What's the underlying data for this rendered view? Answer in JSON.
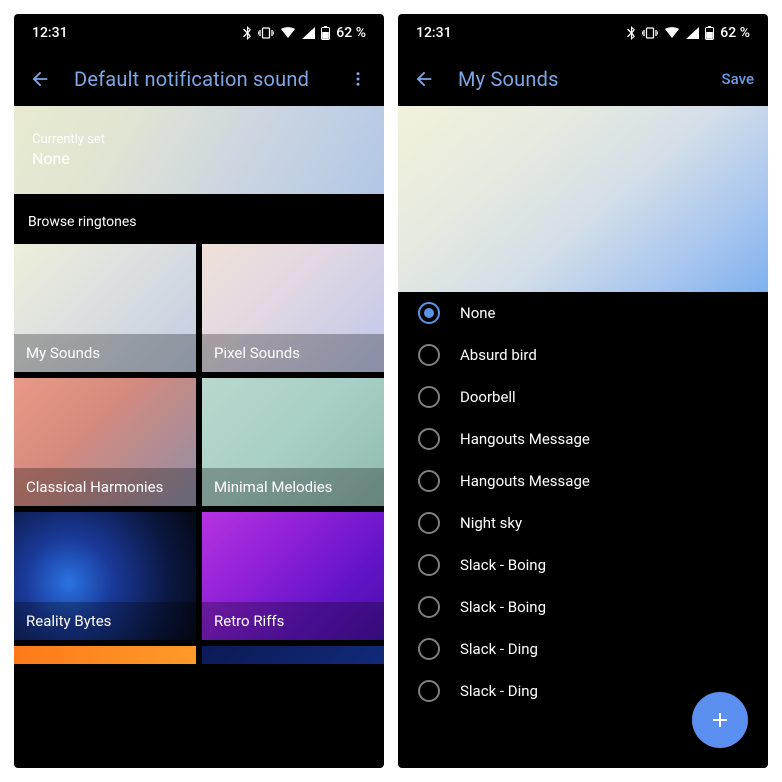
{
  "status": {
    "time": "12:31",
    "battery_text": "62 %"
  },
  "left": {
    "title": "Default notification sound",
    "current_label": "Currently set",
    "current_value": "None",
    "browse_label": "Browse ringtones",
    "categories": [
      {
        "name": "My Sounds"
      },
      {
        "name": "Pixel Sounds"
      },
      {
        "name": "Classical Harmonies"
      },
      {
        "name": "Minimal Melodies"
      },
      {
        "name": "Reality Bytes"
      },
      {
        "name": "Retro Riffs"
      }
    ]
  },
  "right": {
    "title": "My Sounds",
    "save_label": "Save",
    "sounds": [
      {
        "label": "None",
        "selected": true
      },
      {
        "label": "Absurd bird",
        "selected": false
      },
      {
        "label": "Doorbell",
        "selected": false
      },
      {
        "label": "Hangouts Message",
        "selected": false
      },
      {
        "label": "Hangouts Message",
        "selected": false
      },
      {
        "label": "Night sky",
        "selected": false
      },
      {
        "label": "Slack - Boing",
        "selected": false
      },
      {
        "label": "Slack - Boing",
        "selected": false
      },
      {
        "label": "Slack - Ding",
        "selected": false
      },
      {
        "label": "Slack - Ding",
        "selected": false
      }
    ]
  }
}
